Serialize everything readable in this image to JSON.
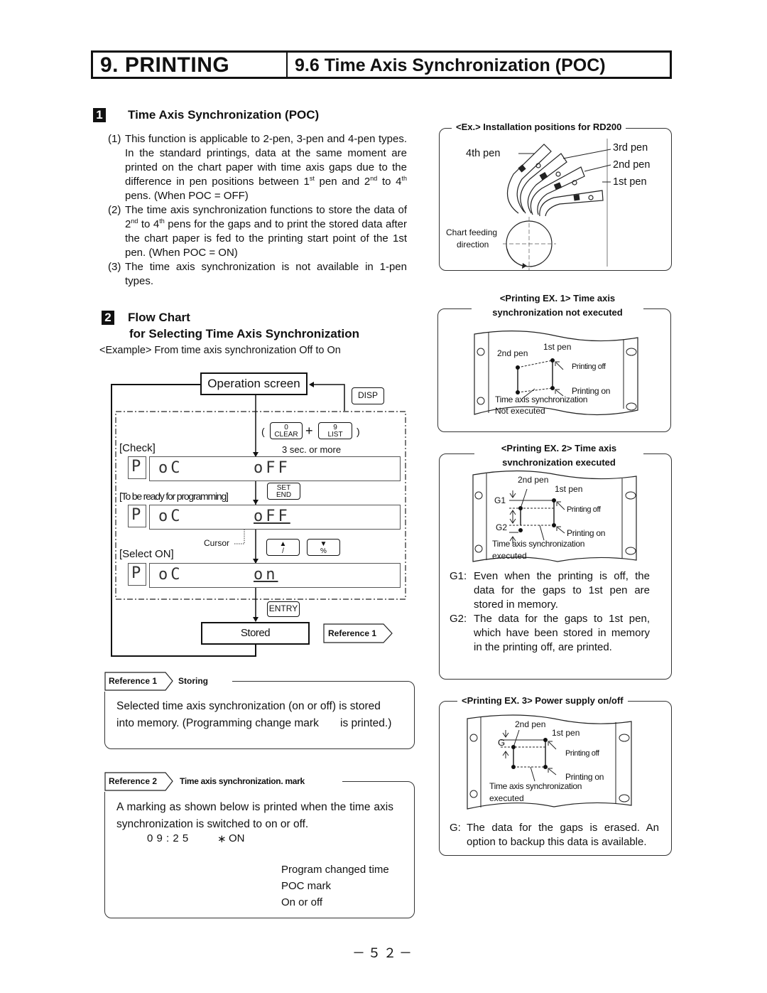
{
  "header": {
    "chapter": "9. PRINTING",
    "section": "9.6 Time Axis Synchronization (POC)"
  },
  "section1": {
    "number": "1",
    "title": "Time Axis Synchronization (POC)",
    "items": [
      {
        "num": "(1)",
        "parts": [
          "This function is applicable to 2-pen, 3-pen and 4-pen types. In the standard printings, data at the same moment are printed on the chart paper with time axis gaps due to the difference in pen positions between 1",
          "st",
          " pen and 2",
          "nd",
          " to 4",
          "th",
          " pens. (When POC = OFF)"
        ]
      },
      {
        "num": "(2)",
        "parts": [
          "The time axis synchronization functions to store the data of 2",
          "nd",
          " to 4",
          "th",
          " pens for the gaps and to print the stored data after the chart paper is fed to the printing start point of the 1st pen. (When POC = ON)"
        ]
      },
      {
        "num": "(3)",
        "parts": [
          "The time axis synchronization is not available in 1-pen types."
        ]
      }
    ]
  },
  "section2": {
    "number": "2",
    "title_line1": "Flow Chart",
    "title_line2": "for Selecting Time Axis Synchronization",
    "example": "<Example> From time axis synchronization Off to On"
  },
  "flowchart": {
    "operation_screen": "Operation screen",
    "disp_key": "DISP",
    "paren_open": "(",
    "paren_close": ")",
    "plus": "+",
    "key_clear_top": "0",
    "key_clear_bottom": "CLEAR",
    "key_list_top": "9",
    "key_list_bottom": "LIST",
    "hold_note": "3 sec. or more",
    "step_check": "[Check]",
    "step_ready": "[To be ready for programming]",
    "step_select": "[Select ON]",
    "key_set": "SET",
    "key_end": "END",
    "cursor_label": "Cursor",
    "key_up_symbol": "▲",
    "key_up_sub": "/",
    "key_down_symbol": "▼",
    "key_down_sub": "%",
    "lcd_rows": [
      {
        "left": "P",
        "param": "oC",
        "value": "oFF",
        "underlined": false
      },
      {
        "left": "P",
        "param": "oC",
        "value": "oFF",
        "underlined": true
      },
      {
        "left": "P",
        "param": "oC",
        "value": "on",
        "underlined": true
      }
    ],
    "entry_key": "ENTRY",
    "stored": "Stored",
    "reference_link": "Reference 1"
  },
  "reference1": {
    "tag": "Reference 1",
    "title": "Storing",
    "text_a": "Selected time axis synchronization (on or off) is stored into memory. (Programming change mark",
    "text_b": "is printed.)"
  },
  "reference2": {
    "tag": "Reference 2",
    "title": "Time axis synchronization. mark",
    "text": "A marking as shown below is printed when the time axis synchronization is switched to on or off.",
    "sample_time": "0 9 : 2 5",
    "sample_mark": "∗",
    "sample_state": "ON",
    "legend": [
      "Program changed time",
      "POC mark",
      "On or off"
    ]
  },
  "install": {
    "title": "<Ex.> Installation positions for RD200",
    "pens": [
      "4th pen",
      "3rd pen",
      "2nd pen",
      "1st pen"
    ],
    "feed_label_1": "Chart feeding",
    "feed_label_2": "direction"
  },
  "ex1": {
    "title_1": "<Printing EX. 1> Time axis",
    "title_2": "synchronization not executed",
    "pen2": "2nd pen",
    "pen1": "1st pen",
    "off": "Printing off",
    "on": "Printing on",
    "note_1": "Time axis synchronization",
    "note_2": "Not executed"
  },
  "ex2": {
    "title_1": "<Printing EX. 2> Time axis",
    "title_2": "svnchronization executed",
    "pen2": "2nd pen",
    "pen1": "1st pen",
    "g1": "G1",
    "g2": "G2",
    "off": "Printing off",
    "on": "Printing on",
    "note_1": "Time axis synchronization",
    "note_2": "executed",
    "notes": [
      {
        "key": "G1:",
        "text": "Even when the printing is off, the data for the gaps to 1st pen are stored in memory."
      },
      {
        "key": "G2:",
        "text": "The data for the gaps to 1st pen, which have been stored in memory in the printing off, are printed."
      }
    ]
  },
  "ex3": {
    "title": "<Printing EX. 3> Power supply on/off",
    "pen2": "2nd pen",
    "pen1": "1st pen",
    "g": "G",
    "off": "Printing off",
    "on": "Printing on",
    "note_1": "Time axis synchronization",
    "note_2": "executed",
    "notes": [
      {
        "key": "G:",
        "text": "The data for the gaps is erased. An option to backup this data is available."
      }
    ]
  },
  "page_number": "－５２－"
}
